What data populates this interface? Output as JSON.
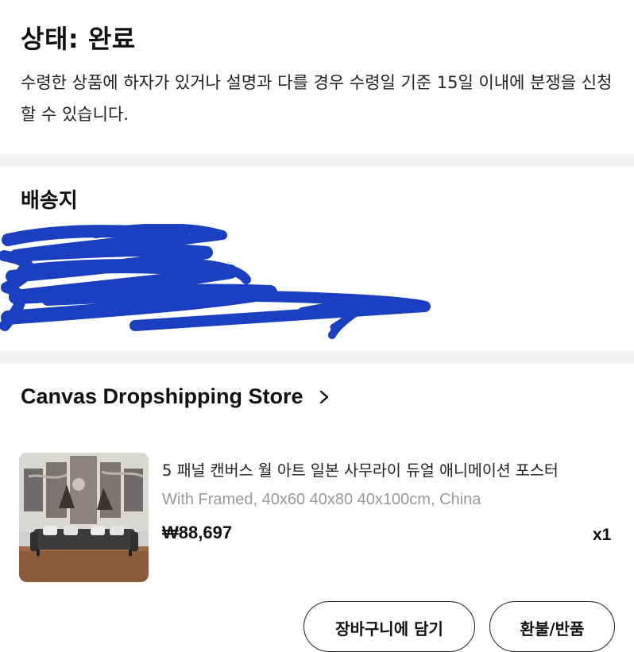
{
  "status": {
    "title": "상태: 완료",
    "description": "수령한 상품에 하자가 있거나 설명과 다를 경우 수령일 기준 15일 이내에 분쟁을 신청할 수 있습니다."
  },
  "shipping": {
    "title": "배송지"
  },
  "store": {
    "name": "Canvas Dropshipping Store",
    "chevron_icon": "chevron-right-icon"
  },
  "product": {
    "title": "5 패널 캔버스 월 아트 일본 사무라이 듀얼 애니메이션 포스터",
    "variant": "With Framed, 40x60 40x80 40x100cm, China",
    "price": "₩88,697",
    "quantity": "x1"
  },
  "actions": {
    "add_to_cart": "장바구니에 담기",
    "refund_return": "환불/반품"
  },
  "colors": {
    "redaction": "#1a3fc0",
    "divider": "#f2f2f2"
  }
}
